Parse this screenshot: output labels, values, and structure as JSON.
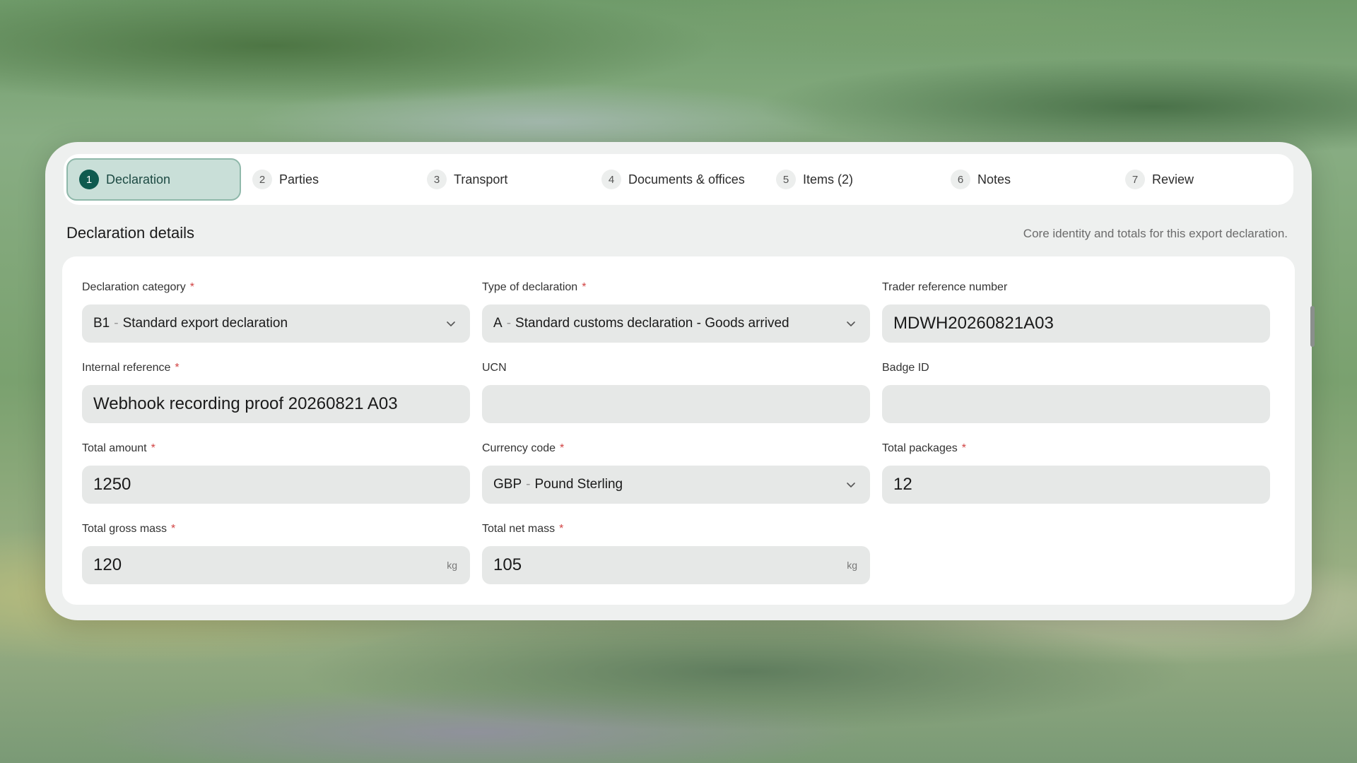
{
  "steps": [
    {
      "num": "1",
      "label": "Declaration"
    },
    {
      "num": "2",
      "label": "Parties"
    },
    {
      "num": "3",
      "label": "Transport"
    },
    {
      "num": "4",
      "label": "Documents & offices"
    },
    {
      "num": "5",
      "label": "Items (2)"
    },
    {
      "num": "6",
      "label": "Notes"
    },
    {
      "num": "7",
      "label": "Review"
    }
  ],
  "active_step": "Declaration",
  "section": {
    "title": "Declaration details",
    "description": "Core identity and totals for this export declaration."
  },
  "fields": {
    "declaration_category": {
      "label": "Declaration category",
      "required": "*",
      "code": "B1",
      "sep": "-",
      "value": "Standard export declaration"
    },
    "type_of_declaration": {
      "label": "Type of declaration",
      "required": "*",
      "code": "A",
      "sep": "-",
      "value": "Standard customs declaration - Goods arrived"
    },
    "trader_reference": {
      "label": "Trader reference number",
      "value": "MDWH20260821A03"
    },
    "internal_reference": {
      "label": "Internal reference",
      "required": "*",
      "value": "Webhook recording proof 20260821 A03"
    },
    "ucn": {
      "label": "UCN",
      "value": ""
    },
    "badge_id": {
      "label": "Badge ID",
      "value": ""
    },
    "total_amount": {
      "label": "Total amount",
      "required": "*",
      "value": "1250"
    },
    "currency_code": {
      "label": "Currency code",
      "required": "*",
      "code": "GBP",
      "sep": "-",
      "value": "Pound Sterling"
    },
    "total_packages": {
      "label": "Total packages",
      "required": "*",
      "value": "12"
    },
    "total_gross_mass": {
      "label": "Total gross mass",
      "required": "*",
      "value": "120",
      "unit": "kg"
    },
    "total_net_mass": {
      "label": "Total net mass",
      "required": "*",
      "value": "105",
      "unit": "kg"
    }
  },
  "colors": {
    "accent": "#0f5a4f",
    "active_step_bg": "#c9dfd8",
    "required": "#d14343"
  },
  "icons": {
    "select": "chevron-down-icon"
  }
}
